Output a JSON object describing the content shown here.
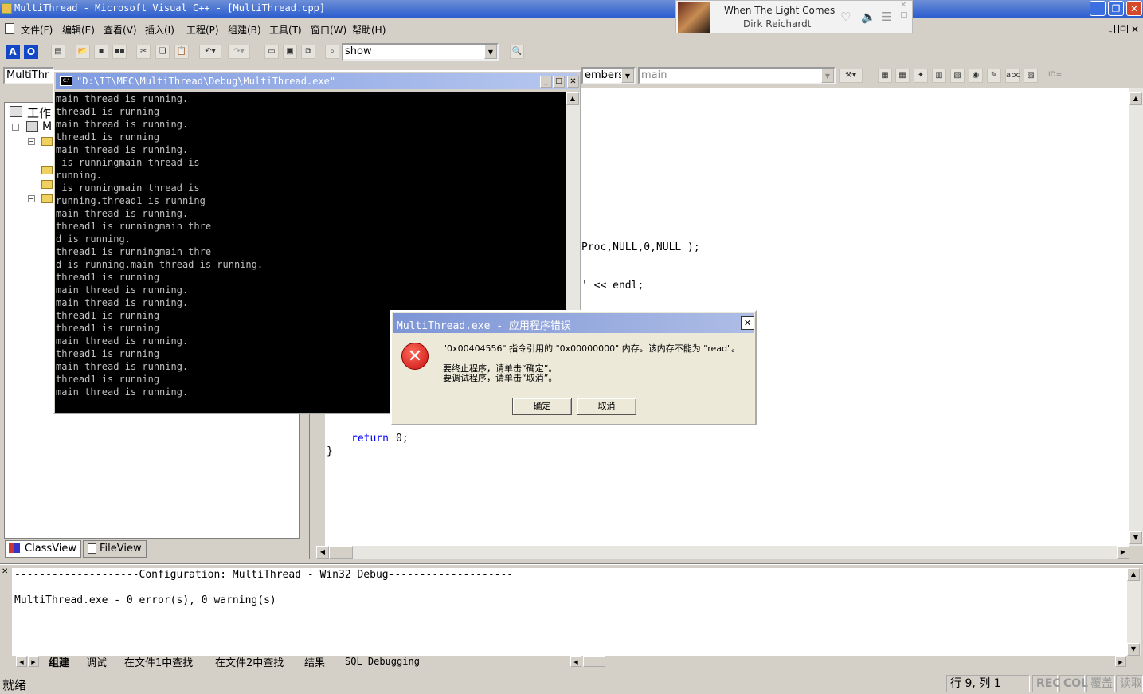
{
  "window": {
    "title": "MultiThread - Microsoft Visual C++ - [MultiThread.cpp]"
  },
  "music": {
    "song": "When The Light Comes",
    "artist": "Dirk Reichardt"
  },
  "menu": [
    "文件(F)",
    "编辑(E)",
    "查看(V)",
    "插入(I)",
    "工程(P)",
    "组建(B)",
    "工具(T)",
    "窗口(W)",
    "帮助(H)"
  ],
  "toolbar": {
    "find_combo": "show",
    "class_combo": "MultiThr",
    "members_combo": "embers",
    "function_combo": "main"
  },
  "workspace": {
    "root_label": "工作",
    "project_label": "M",
    "tabs": [
      "ClassView",
      "FileView"
    ]
  },
  "editor": {
    "lines": [
      "Proc,NULL,0,NULL );",
      "' << endl;",
      "return 0;",
      "}"
    ]
  },
  "console": {
    "title": "\"D:\\IT\\MFC\\MultiThread\\Debug\\MultiThread.exe\"",
    "lines": [
      "main thread is running.",
      "thread1 is running",
      "main thread is running.",
      "thread1 is running",
      "main thread is running.",
      " is runningmain thread is",
      "running.",
      " is runningmain thread is",
      "running.thread1 is running",
      "main thread is running.",
      "thread1 is runningmain thre",
      "d is running.",
      "thread1 is runningmain thre",
      "d is running.main thread is running.",
      "thread1 is running",
      "main thread is running.",
      "main thread is running.",
      "thread1 is running",
      "thread1 is running",
      "main thread is running.",
      "thread1 is running",
      "main thread is running.",
      "thread1 is running",
      "main thread is running."
    ]
  },
  "dialog": {
    "title": "MultiThread.exe - 应用程序错误",
    "message1": "\"0x00404556\" 指令引用的 \"0x00000000\" 内存。该内存不能为 \"read\"。",
    "message2": "要终止程序，请单击“确定”。",
    "message3": "要调试程序，请单击“取消”。",
    "ok_label": "确定",
    "cancel_label": "取消"
  },
  "output": {
    "line1": "--------------------Configuration: MultiThread - Win32 Debug--------------------",
    "line2": "MultiThread.exe - 0 error(s), 0 warning(s)",
    "tabs": [
      "组建",
      "调试",
      "在文件1中查找",
      "在文件2中查找",
      "结果",
      "SQL Debugging"
    ]
  },
  "status": {
    "text": "就绪",
    "position": "行 9, 列 1",
    "rec": "REC",
    "col": "COL",
    "ovr": "覆盖",
    "read": "读取"
  }
}
